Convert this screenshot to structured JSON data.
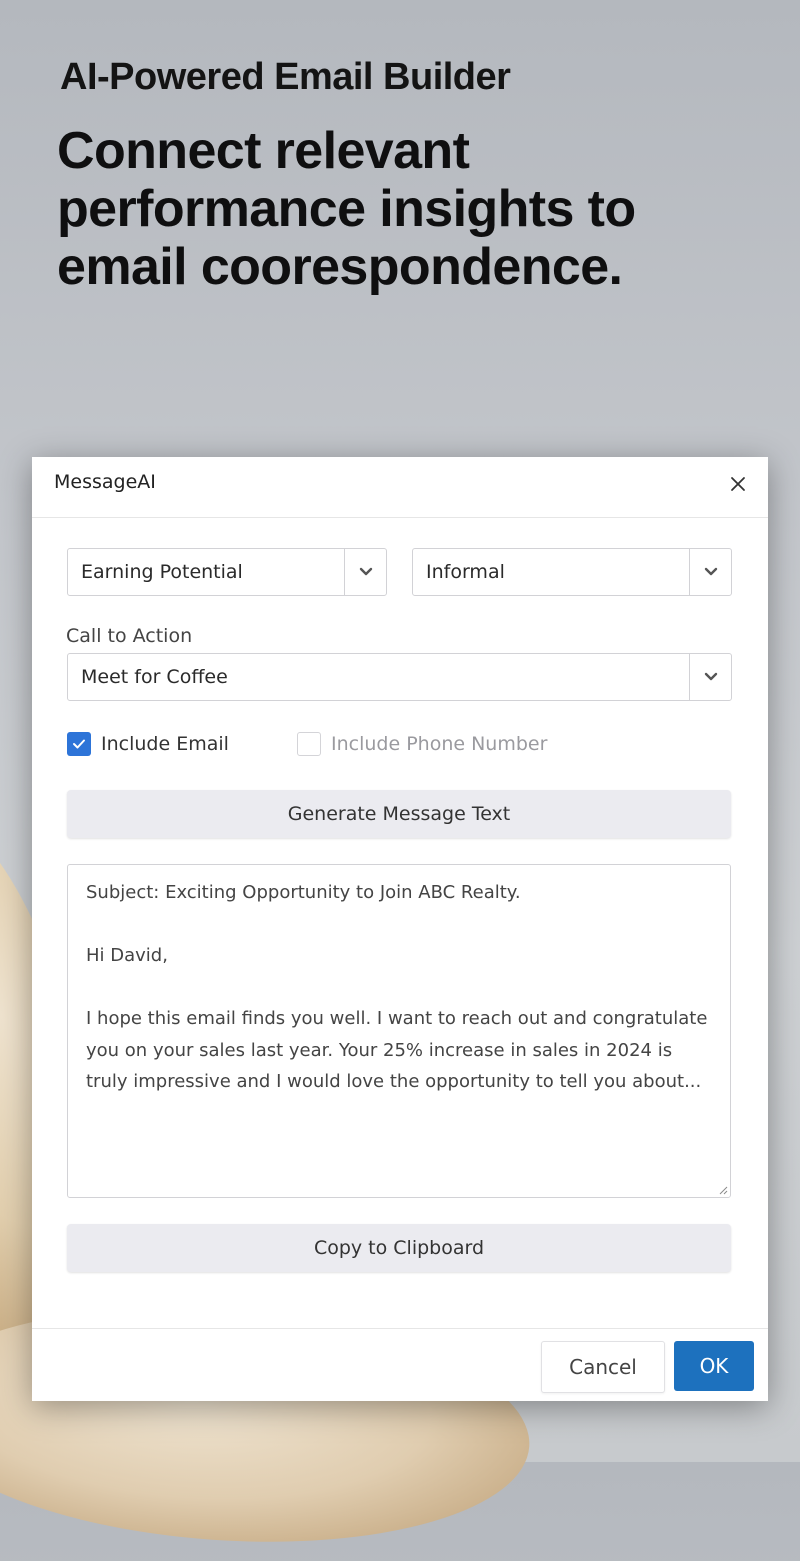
{
  "hero": {
    "eyebrow": "AI-Powered Email Builder",
    "headline": "Connect relevant performance insights to email coorespondence."
  },
  "dialog": {
    "title": "MessageAI",
    "close_icon": "close-icon",
    "topic_select": {
      "value": "Earning Potential",
      "icon": "chevron-down-icon"
    },
    "tone_select": {
      "value": "Informal",
      "icon": "chevron-down-icon"
    },
    "cta": {
      "label": "Call to Action",
      "value": "Meet for Coffee",
      "icon": "chevron-down-icon"
    },
    "include_email": {
      "label": "Include Email",
      "checked": true
    },
    "include_phone": {
      "label": "Include Phone Number",
      "checked": false
    },
    "generate_button": "Generate Message Text",
    "message": {
      "subject": "Subject: Exciting Opportunity to Join ABC Realty.",
      "greeting": "Hi David,",
      "body": "I hope this email finds you well. I want to reach out and congratulate you on your sales last year. Your 25% increase in sales in 2024 is truly impressive and I would love the opportunity to tell you about..."
    },
    "copy_button": "Copy to Clipboard",
    "footer": {
      "cancel_label": "Cancel",
      "ok_label": "OK"
    }
  },
  "colors": {
    "primary": "#1d71be",
    "checkbox_on": "#2d74d8",
    "button_gray": "#ebebf0"
  }
}
